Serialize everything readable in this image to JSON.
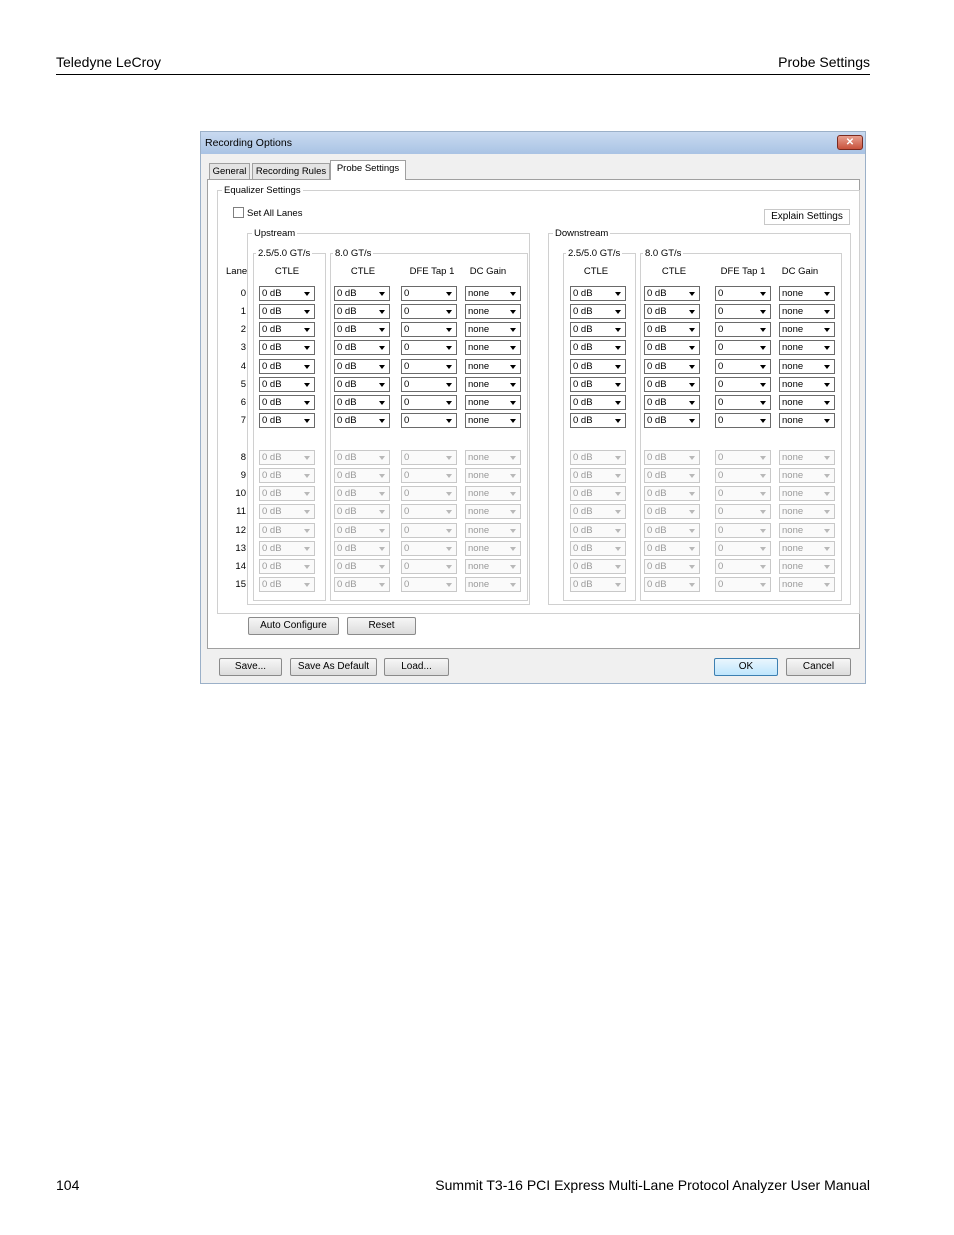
{
  "page": {
    "header_left": "Teledyne LeCroy",
    "header_right": "Probe Settings",
    "footer_left": "104",
    "footer_right": "Summit T3-16 PCI Express Multi-Lane Protocol Analyzer User Manual"
  },
  "dialog": {
    "title": "Recording Options",
    "close_label": "✕",
    "tabs": [
      "General",
      "Recording Rules",
      "Probe Settings"
    ],
    "active_tab": "Probe Settings",
    "equalizer": {
      "group_title": "Equalizer Settings",
      "set_all_lanes": "Set All Lanes",
      "set_all_lanes_checked": false,
      "explain_button": "Explain Settings",
      "lane_header": "Lane",
      "upstream": "Upstream",
      "downstream": "Downstream",
      "speed_groups": [
        "2.5/5.0 GT/s",
        "8.0 GT/s"
      ],
      "columns": [
        "CTLE",
        "CTLE",
        "DFE Tap 1",
        "DC Gain"
      ],
      "lanes": [
        "0",
        "1",
        "2",
        "3",
        "4",
        "5",
        "6",
        "7",
        "8",
        "9",
        "10",
        "11",
        "12",
        "13",
        "14",
        "15"
      ],
      "enabled_lanes": 8,
      "values": [
        "0 dB",
        "0 dB",
        "0",
        "none"
      ]
    },
    "auto_configure": "Auto Configure",
    "reset": "Reset",
    "save": "Save...",
    "save_default": "Save As Default",
    "load": "Load...",
    "ok": "OK",
    "cancel": "Cancel"
  }
}
